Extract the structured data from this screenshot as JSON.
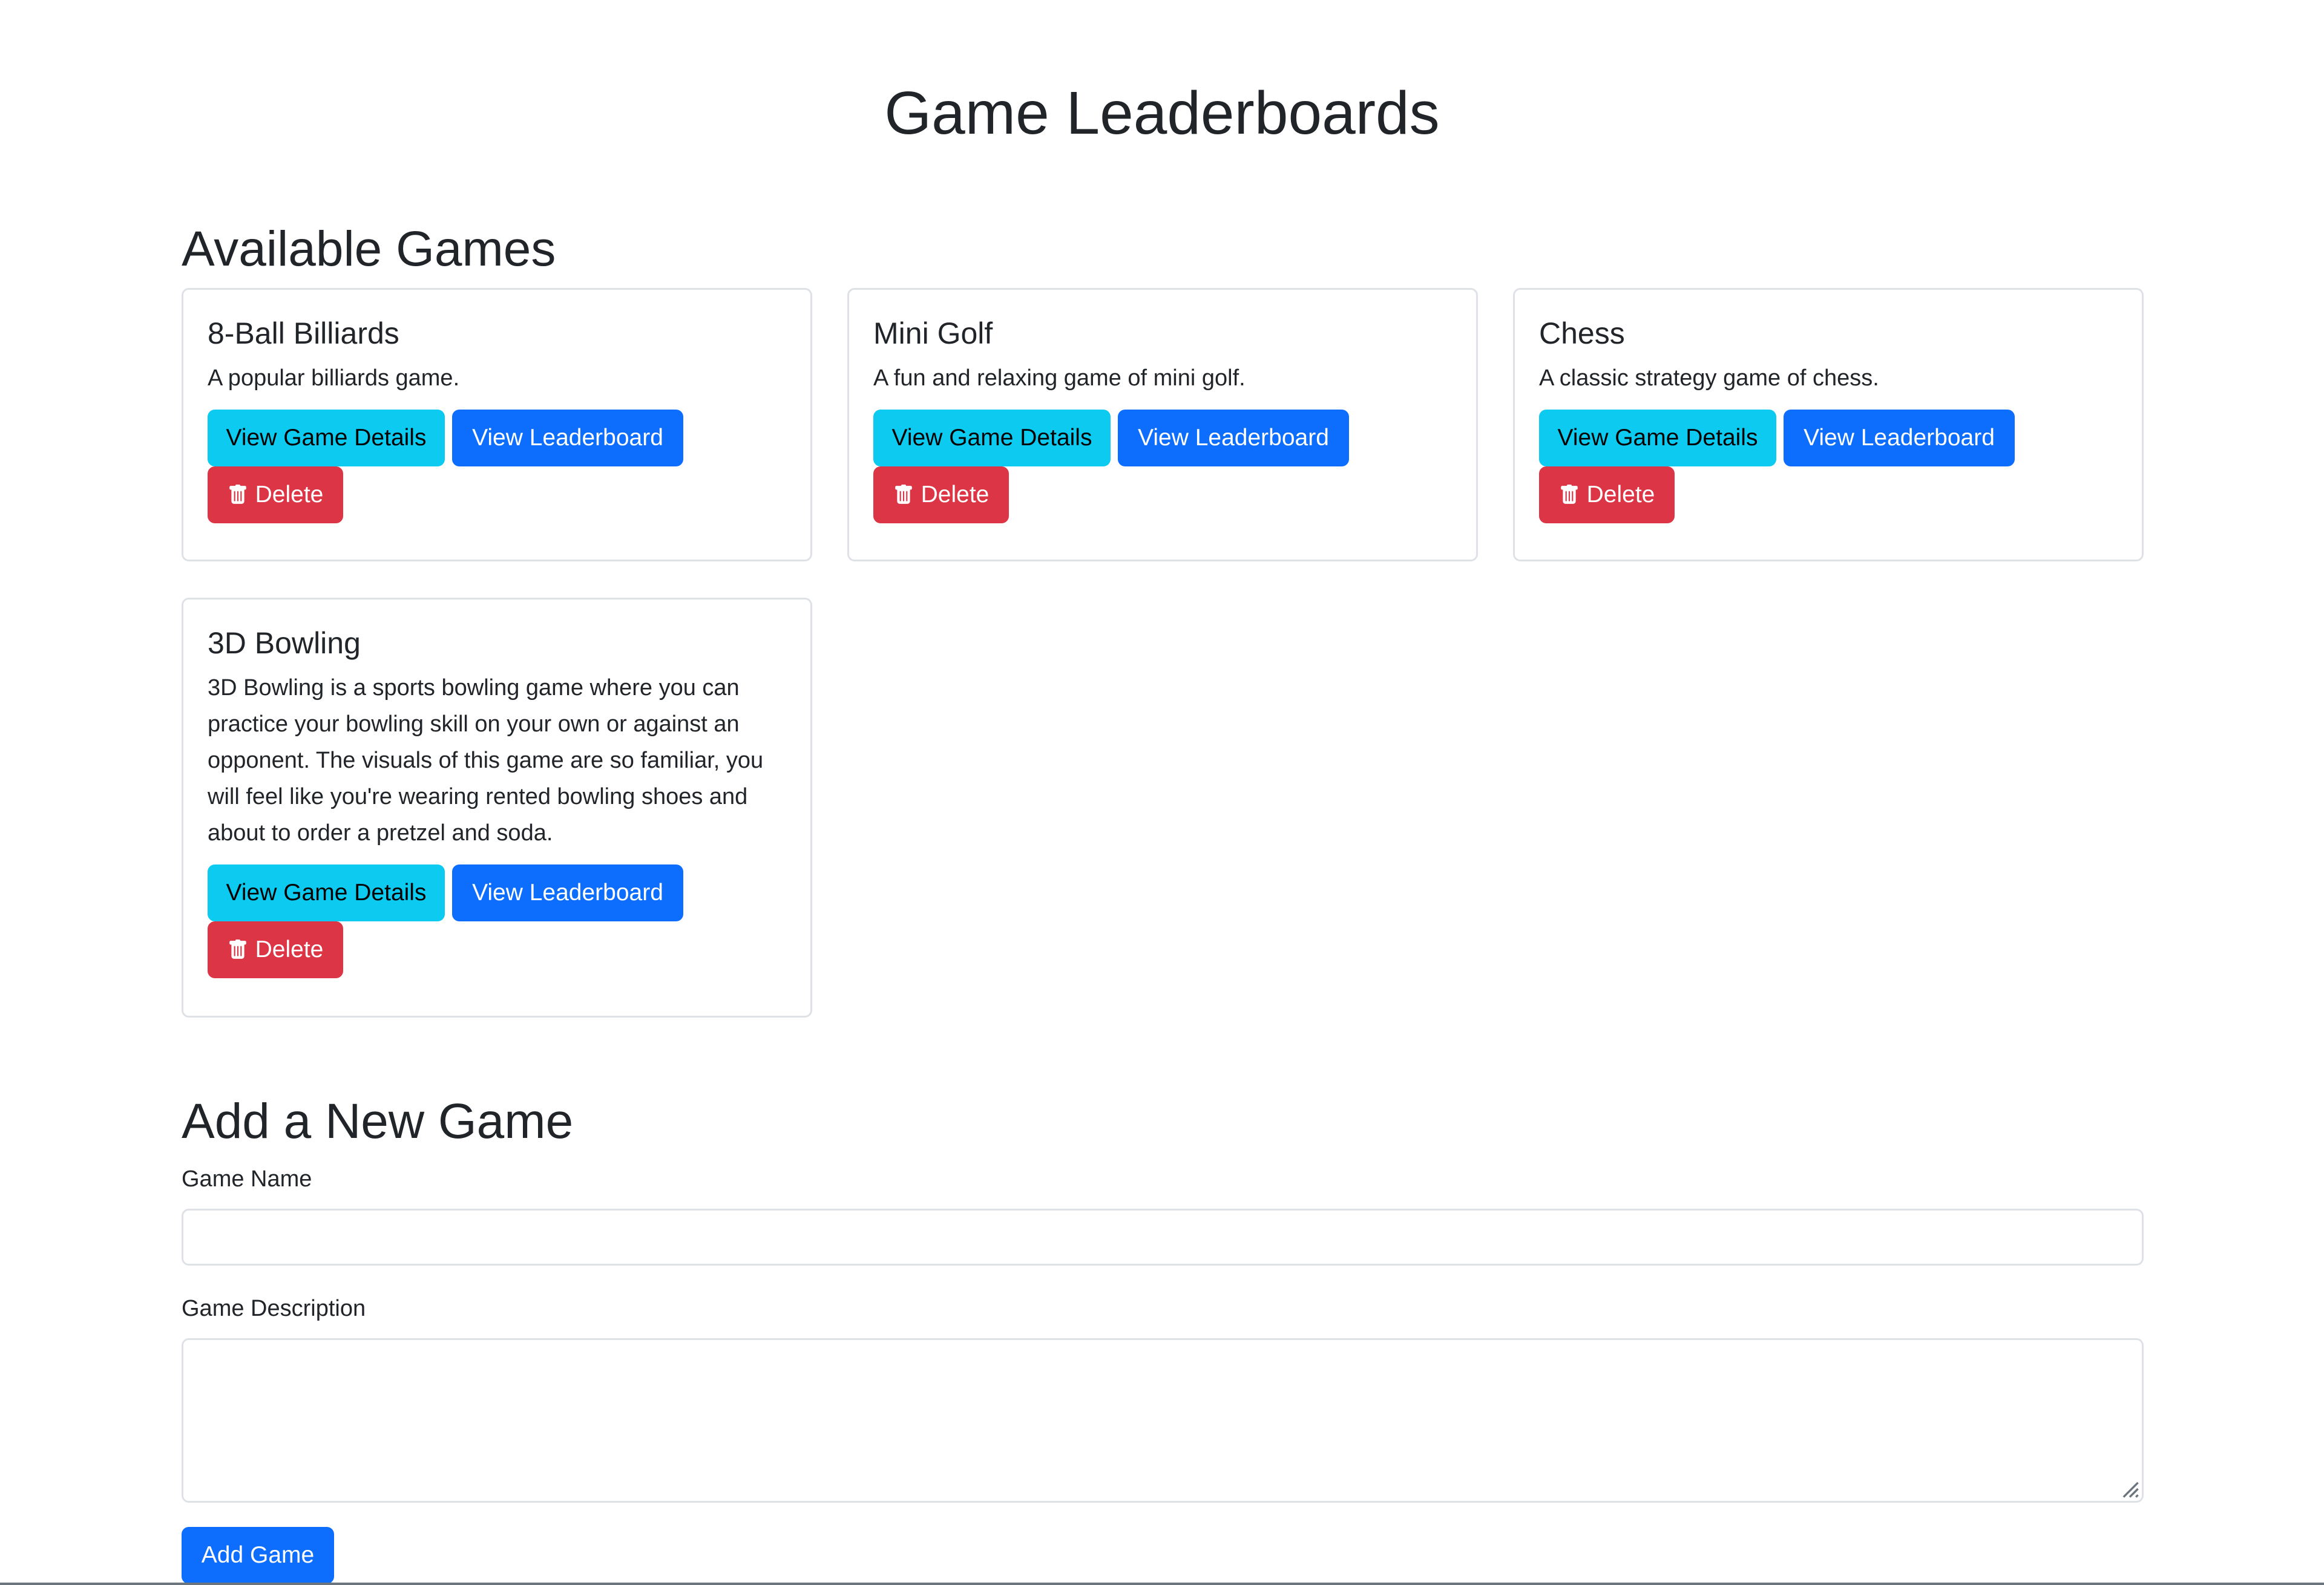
{
  "page": {
    "title": "Game Leaderboards"
  },
  "available_games": {
    "heading": "Available Games",
    "games": [
      {
        "name": "8-Ball Billiards",
        "description": "A popular billiards game.",
        "details_label": "View Game Details",
        "leaderboard_label": "View Leaderboard",
        "delete_label": "Delete"
      },
      {
        "name": "Mini Golf",
        "description": "A fun and relaxing game of mini golf.",
        "details_label": "View Game Details",
        "leaderboard_label": "View Leaderboard",
        "delete_label": "Delete"
      },
      {
        "name": "Chess",
        "description": "A classic strategy game of chess.",
        "details_label": "View Game Details",
        "leaderboard_label": "View Leaderboard",
        "delete_label": "Delete"
      },
      {
        "name": "3D Bowling",
        "description": "3D Bowling is a sports bowling game where you can practice your bowling skill on your own or against an opponent. The visuals of this game are so familiar, you will feel like you're wearing rented bowling shoes and about to order a pretzel and soda.",
        "details_label": "View Game Details",
        "leaderboard_label": "View Leaderboard",
        "delete_label": "Delete"
      }
    ]
  },
  "add_game": {
    "heading": "Add a New Game",
    "name_label": "Game Name",
    "name_value": "",
    "description_label": "Game Description",
    "description_value": "",
    "submit_label": "Add Game"
  },
  "colors": {
    "info": "#0dcaf0",
    "primary": "#0d6efd",
    "danger": "#dc3545",
    "border": "#dee2e6",
    "text": "#212529"
  },
  "icons": {
    "delete": "trash-icon",
    "textarea_resize": "resize-grip-icon"
  }
}
